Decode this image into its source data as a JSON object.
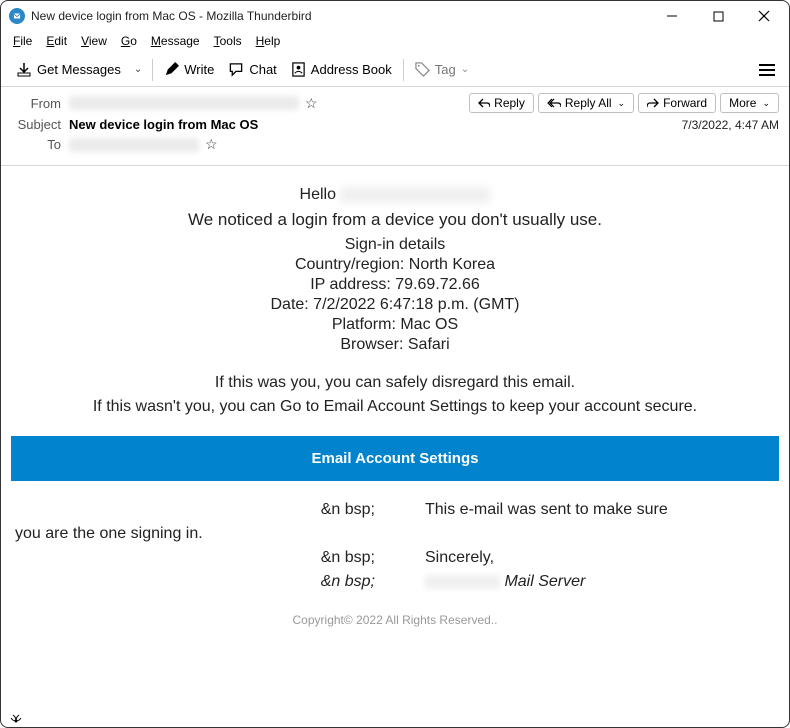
{
  "window": {
    "title": "New device login from Mac OS - Mozilla Thunderbird"
  },
  "menu": {
    "file": "File",
    "edit": "Edit",
    "view": "View",
    "go": "Go",
    "message": "Message",
    "tools": "Tools",
    "help": "Help"
  },
  "toolbar": {
    "get_messages": "Get Messages",
    "write": "Write",
    "chat": "Chat",
    "address_book": "Address Book",
    "tag": "Tag"
  },
  "headers": {
    "from_label": "From",
    "subject_label": "Subject",
    "to_label": "To",
    "subject": "New device login from Mac OS",
    "date": "7/3/2022, 4:47 AM",
    "actions": {
      "reply": "Reply",
      "reply_all": "Reply All",
      "forward": "Forward",
      "more": "More"
    }
  },
  "body": {
    "hello": "Hello",
    "notice": "We noticed a login from a device you don't usually use.",
    "signin_heading": "Sign-in details",
    "country": "Country/region: North Korea",
    "ip": "IP address: 79.69.72.66",
    "date_line": "Date: 7/2/2022 6:47:18 p.m. (GMT)",
    "platform": "Platform: Mac OS",
    "browser": "Browser: Safari",
    "disregard1": "If this was you, you can safely disregard this email.",
    "disregard2": "If this wasn't you, you can Go to Email Account Settings to keep your account secure.",
    "cta": "Email Account Settings",
    "nbsp": "&n bsp;",
    "sent_to_make_sure": "This e-mail was sent to make sure",
    "you_are_signing": "you are the one signing in.",
    "sincerely": "Sincerely,",
    "mail_server": "Mail Server",
    "copyright": "Copyright© 2022 All Rights Reserved.."
  }
}
